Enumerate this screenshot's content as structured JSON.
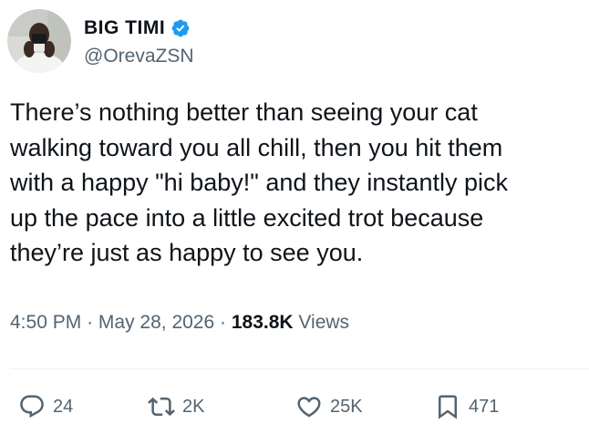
{
  "author": {
    "display_name": "BIG TIMI",
    "handle": "@OrevaZSN",
    "verified": true,
    "verified_color": "#1d9bf0"
  },
  "post": {
    "text": "There’s nothing better than seeing your cat\nwalking toward you all chill, then you hit them\nwith a happy \"hi baby!\" and they instantly pick\nup the pace into a little excited trot because\nthey’re just as happy to see you."
  },
  "meta": {
    "time": "4:50 PM",
    "separator": "·",
    "date": "May 28, 2026",
    "views_count": "183.8K",
    "views_label": "Views"
  },
  "actions": {
    "replies": {
      "icon": "reply-icon",
      "count": "24"
    },
    "reposts": {
      "icon": "repost-icon",
      "count": "2K"
    },
    "likes": {
      "icon": "like-icon",
      "count": "25K"
    },
    "bookmarks": {
      "icon": "bookmark-icon",
      "count": "471"
    }
  },
  "colors": {
    "text_primary": "#0f1419",
    "text_secondary": "#536471",
    "divider": "#eff3f4"
  }
}
